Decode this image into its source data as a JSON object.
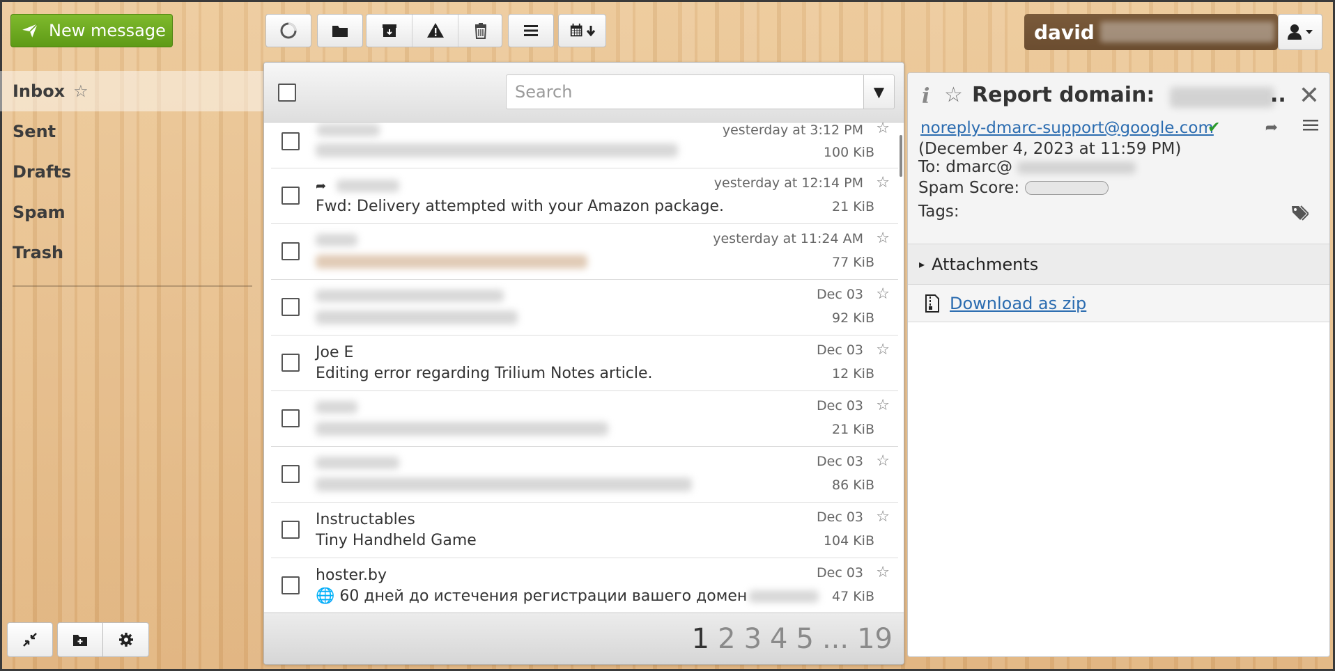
{
  "toolbar": {
    "new_message_label": "New message",
    "buttons": [
      "refresh-icon",
      "folder-icon",
      "archive-icon",
      "spam-icon",
      "trash-icon",
      "list-icon",
      "calendar-download-icon"
    ]
  },
  "user": {
    "name": "david"
  },
  "sidebar": {
    "folders": [
      {
        "label": "Inbox",
        "active": true
      },
      {
        "label": "Sent"
      },
      {
        "label": "Drafts"
      },
      {
        "label": "Spam"
      },
      {
        "label": "Trash"
      }
    ]
  },
  "list": {
    "search_placeholder": "Search",
    "messages": [
      {
        "from": "",
        "subject": "",
        "date": "yesterday at 3:12 PM",
        "size": "100 KiB",
        "replied": false
      },
      {
        "from": "",
        "subject": "Fwd: Delivery attempted with your Amazon package.",
        "date": "yesterday at 12:14 PM",
        "size": "21 KiB",
        "replied": true
      },
      {
        "from": "",
        "subject": "",
        "date": "yesterday at 11:24 AM",
        "size": "77 KiB",
        "replied": false
      },
      {
        "from": "",
        "subject": "",
        "date": "Dec 03",
        "size": "92 KiB",
        "replied": false
      },
      {
        "from": "Joe E",
        "subject": "Editing error regarding Trilium Notes article.",
        "date": "Dec 03",
        "size": "12 KiB",
        "replied": false
      },
      {
        "from": "",
        "subject": "",
        "date": "Dec 03",
        "size": "21 KiB",
        "replied": false
      },
      {
        "from": "",
        "subject": "",
        "date": "Dec 03",
        "size": "86 KiB",
        "replied": false
      },
      {
        "from": "Instructables",
        "subject": "Tiny Handheld Game",
        "date": "Dec 03",
        "size": "104 KiB",
        "replied": false
      },
      {
        "from": "hoster.by",
        "subject": "🌐 60 дней до истечения регистрации вашего домен",
        "date": "Dec 03",
        "size": "47 KiB",
        "replied": false
      }
    ],
    "pagination": {
      "pages": [
        "1",
        "2",
        "3",
        "4",
        "5"
      ],
      "ellipsis": "...",
      "last": "19",
      "current": "1"
    }
  },
  "preview": {
    "title": "Report domain:",
    "title_ellipsis": "..",
    "from": "noreply-dmarc-support@google.com",
    "date": "(December 4, 2023 at 11:59 PM)",
    "to": "To: dmarc@",
    "spam_label": "Spam Score:",
    "tags_label": "Tags:",
    "attachments_label": "Attachments",
    "download_label": "Download as zip"
  }
}
